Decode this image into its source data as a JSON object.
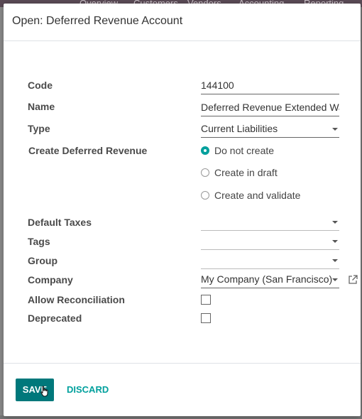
{
  "background_nav": {
    "items": [
      "Overview",
      "Customers",
      "Vendors",
      "Accounting",
      "Reporting"
    ]
  },
  "dialog": {
    "title": "Open: Deferred Revenue Account",
    "fields": {
      "code": {
        "label": "Code",
        "value": "144100"
      },
      "name": {
        "label": "Name",
        "value": "Deferred Revenue Extended Warranty"
      },
      "type": {
        "label": "Type",
        "value": "Current Liabilities"
      },
      "create_deferred": {
        "label": "Create Deferred Revenue",
        "options": [
          "Do not create",
          "Create in draft",
          "Create and validate"
        ],
        "selected": "Do not create"
      },
      "default_taxes": {
        "label": "Default Taxes",
        "value": ""
      },
      "tags": {
        "label": "Tags",
        "value": ""
      },
      "group": {
        "label": "Group",
        "value": ""
      },
      "company": {
        "label": "Company",
        "value": "My Company (San Francisco)"
      },
      "allow_reconciliation": {
        "label": "Allow Reconciliation",
        "checked": false
      },
      "deprecated": {
        "label": "Deprecated",
        "checked": false
      }
    },
    "footer": {
      "save_label": "SAVE",
      "discard_label": "DISCARD"
    }
  },
  "colors": {
    "primary": "#00787b",
    "accent": "#00a09d"
  },
  "icons": {
    "external_link": "external-link-icon",
    "dropdown": "caret-down-icon",
    "cursor": "hand-pointer-icon"
  }
}
